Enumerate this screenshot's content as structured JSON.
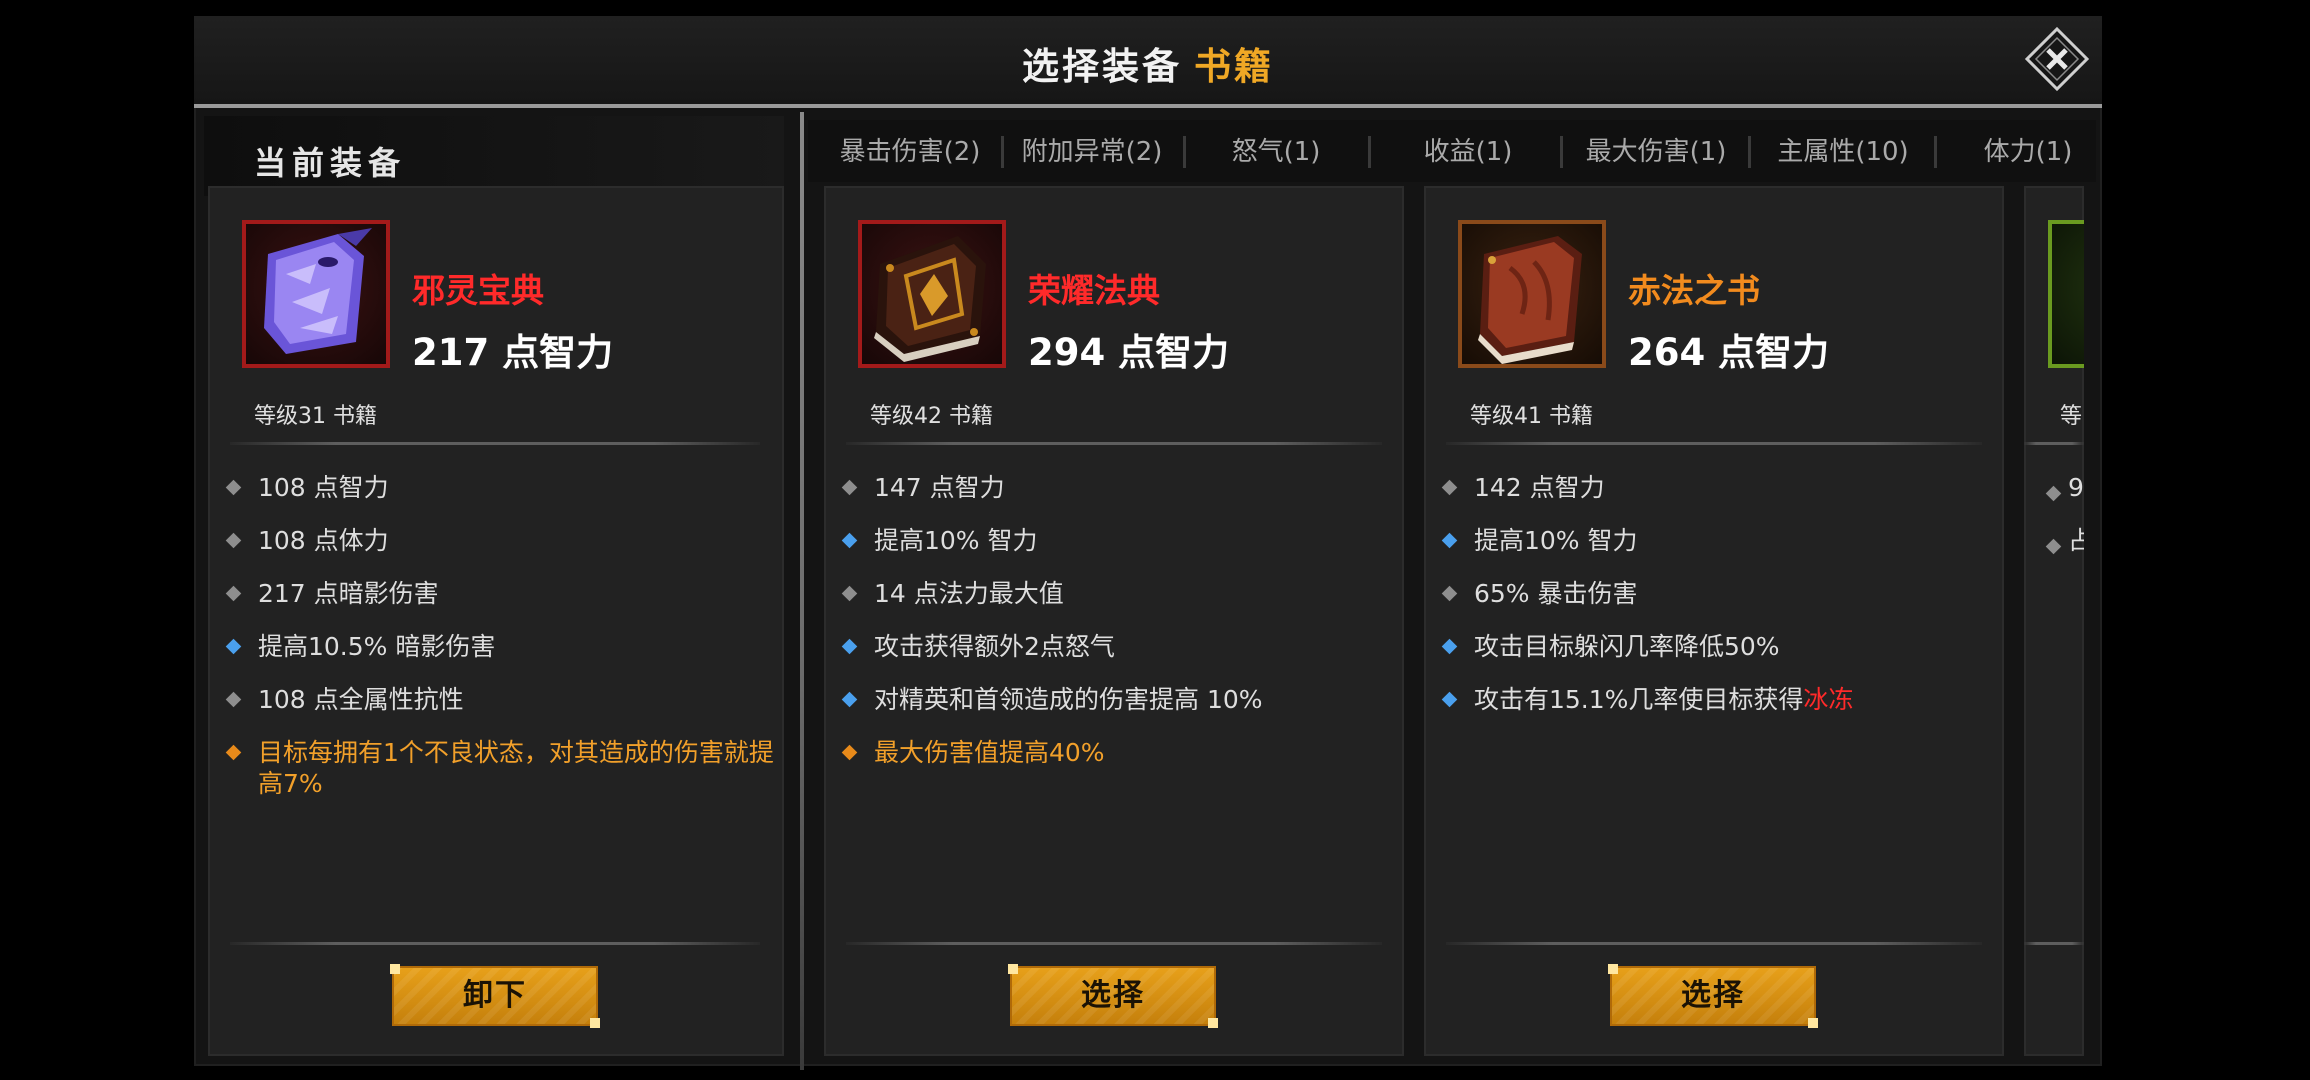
{
  "header": {
    "title": "选择装备",
    "category": "书籍",
    "close_icon": "close-x-diamond-icon"
  },
  "current_section": {
    "label": "当前装备"
  },
  "filter_tabs": [
    {
      "label": "暴击伤害(2)"
    },
    {
      "label": "附加异常(2)"
    },
    {
      "label": "怒气(1)"
    },
    {
      "label": "收益(1)"
    },
    {
      "label": "最大伤害(1)"
    },
    {
      "label": "主属性(10)"
    },
    {
      "label": "体力(1)"
    }
  ],
  "cards": [
    {
      "name": "邪灵宝典",
      "name_color": "#ff2a2a",
      "icon": "purple-spiked-book-icon",
      "stat": "217 点智力",
      "level": "等级31 书籍",
      "attributes": [
        {
          "text": "108 点智力",
          "marker": "grey"
        },
        {
          "text": "108 点体力",
          "marker": "grey"
        },
        {
          "text": "217 点暗影伤害",
          "marker": "grey"
        },
        {
          "text": "提高10.5% 暗影伤害",
          "marker": "blue"
        },
        {
          "text": "108 点全属性抗性",
          "marker": "grey"
        },
        {
          "text": "目标每拥有1个不良状态，对其造成的伤害就提高7%",
          "marker": "gold"
        }
      ],
      "button_label": "卸下"
    },
    {
      "name": "荣耀法典",
      "name_color": "#ff2a2a",
      "icon": "dark-rune-tome-icon",
      "stat": "294 点智力",
      "level": "等级42 书籍",
      "attributes": [
        {
          "text": "147 点智力",
          "marker": "grey"
        },
        {
          "text": "提高10% 智力",
          "marker": "blue"
        },
        {
          "text": "14 点法力最大值",
          "marker": "grey"
        },
        {
          "text": "攻击获得额外2点怒气",
          "marker": "blue"
        },
        {
          "text": "对精英和首领造成的伤害提高 10%",
          "marker": "blue"
        },
        {
          "text": "最大伤害值提高40%",
          "marker": "gold"
        }
      ],
      "button_label": "选择"
    },
    {
      "name": "赤法之书",
      "name_color": "#f28b1e",
      "icon": "red-leather-book-icon",
      "stat": "264 点智力",
      "level": "等级41 书籍",
      "attributes": [
        {
          "text": "142 点智力",
          "marker": "grey"
        },
        {
          "text": "提高10% 智力",
          "marker": "blue"
        },
        {
          "text": "65% 暴击伤害",
          "marker": "grey"
        },
        {
          "text": "攻击目标躲闪几率降低50%",
          "marker": "blue"
        },
        {
          "text": "攻击有15.1%几率使目标获得",
          "highlight": "冰冻",
          "marker": "blue"
        }
      ],
      "button_label": "选择"
    }
  ],
  "partial_card": {
    "level_fragment": "等",
    "attr_fragments": [
      "9",
      "占"
    ]
  },
  "colors": {
    "accent": "#f0a825",
    "legendary_red": "#ff2a2a",
    "epic_orange": "#f28b1e",
    "button_gold": "#e7a01a",
    "marker_blue": "#4aa0ee"
  }
}
